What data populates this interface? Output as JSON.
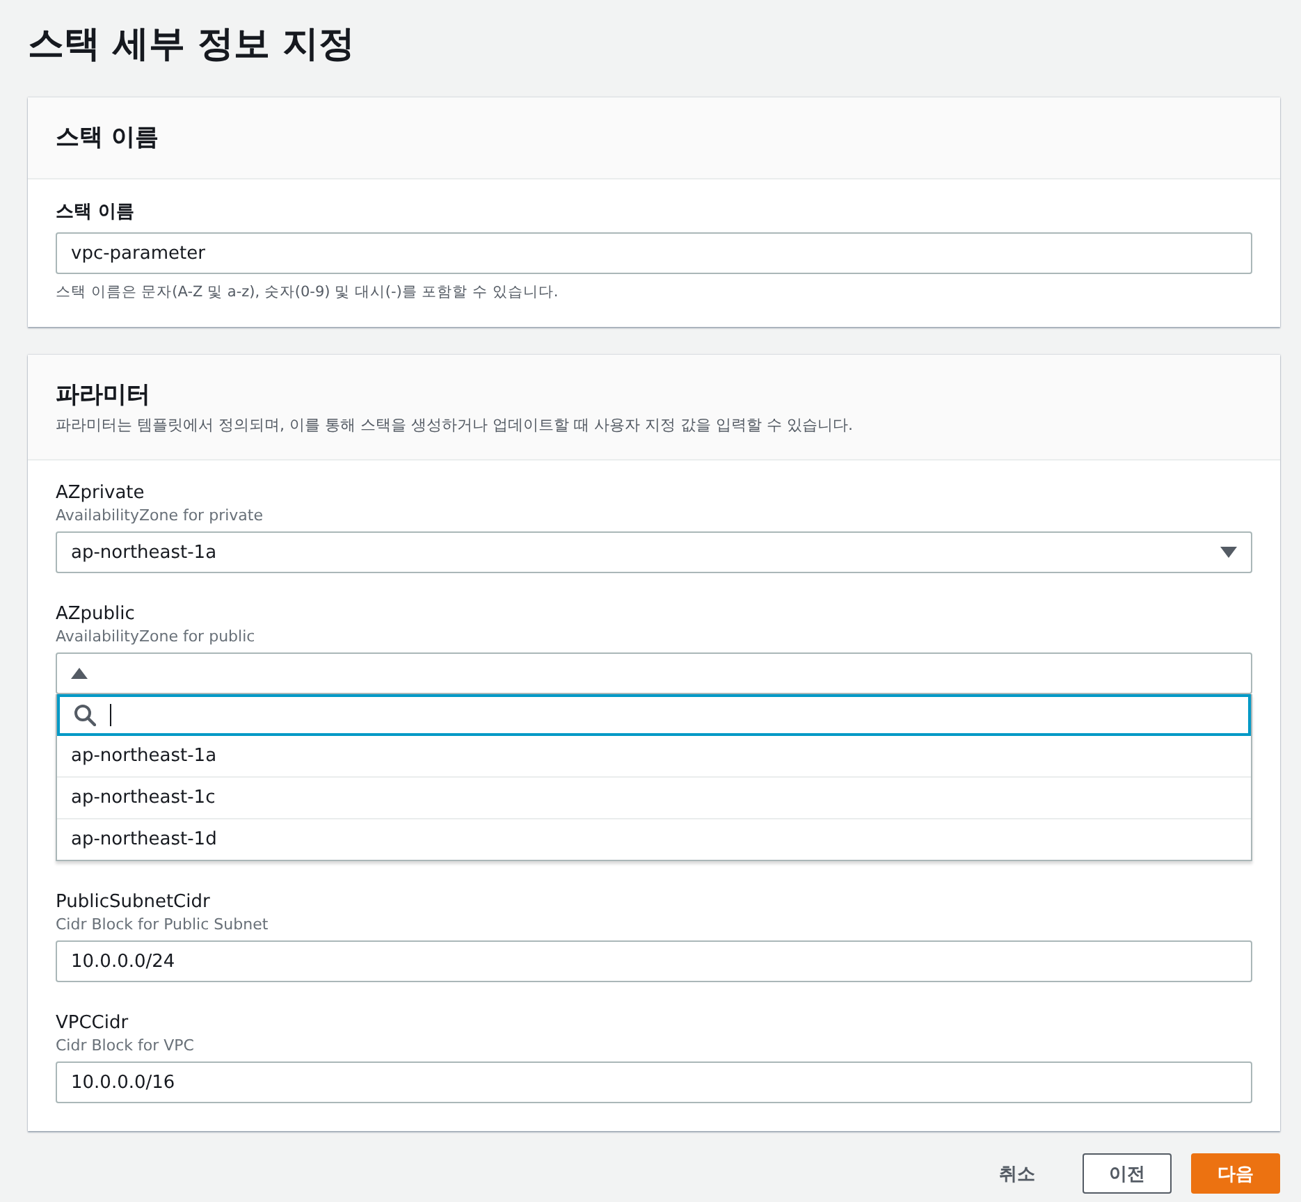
{
  "page_title": "스택 세부 정보 지정",
  "stack_name_panel": {
    "title": "스택 이름",
    "field_label": "스택 이름",
    "value": "vpc-parameter",
    "hint": "스택 이름은 문자(A-Z 및 a-z), 숫자(0-9) 및 대시(-)를 포함할 수 있습니다."
  },
  "parameters_panel": {
    "title": "파라미터",
    "description": "파라미터는 템플릿에서 정의되며, 이를 통해 스택을 생성하거나 업데이트할 때 사용자 지정 값을 입력할 수 있습니다.",
    "parameters": [
      {
        "kind": "select",
        "name": "AZprivate",
        "description": "AvailabilityZone for private",
        "value": "ap-northeast-1a",
        "expanded": false
      },
      {
        "kind": "select",
        "name": "AZpublic",
        "description": "AvailabilityZone for public",
        "expanded": true,
        "options": [
          "ap-northeast-1a",
          "ap-northeast-1c",
          "ap-northeast-1d"
        ]
      },
      {
        "kind": "input",
        "name": "PublicSubnetCidr",
        "description": "Cidr Block for Public Subnet",
        "value": "10.0.0.0/24"
      },
      {
        "kind": "input",
        "name": "VPCCidr",
        "description": "Cidr Block for VPC",
        "value": "10.0.0.0/16"
      }
    ]
  },
  "buttons": [
    {
      "kind": "link",
      "label": "취소"
    },
    {
      "kind": "secondary",
      "label": "이전"
    },
    {
      "kind": "primary",
      "label": "다음"
    }
  ]
}
